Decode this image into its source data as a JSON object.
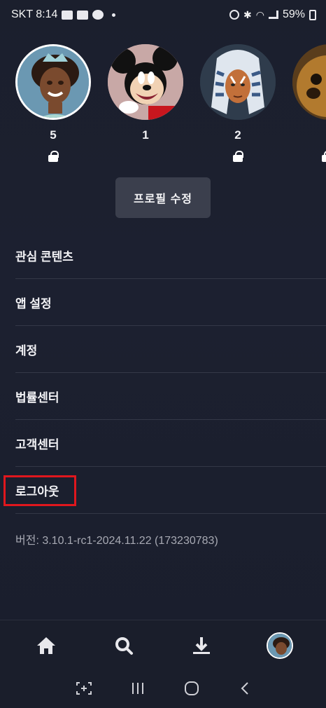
{
  "status_bar": {
    "carrier_time": "SKT 8:14",
    "battery": "59%"
  },
  "profiles": [
    {
      "number": "5",
      "locked": true,
      "selected": true,
      "avatar": "princess-tiana-avatar"
    },
    {
      "number": "1",
      "locked": false,
      "selected": false,
      "avatar": "mickey-mouse-avatar"
    },
    {
      "number": "2",
      "locked": true,
      "selected": false,
      "avatar": "ahsoka-avatar"
    },
    {
      "number": "",
      "locked": true,
      "selected": false,
      "avatar": "animal-avatar"
    }
  ],
  "edit_profile_label": "프로필 수정",
  "menu": {
    "items": [
      {
        "label": "관심 콘텐츠"
      },
      {
        "label": "앱 설정"
      },
      {
        "label": "계정"
      },
      {
        "label": "법률센터"
      },
      {
        "label": "고객센터"
      },
      {
        "label": "로그아웃"
      }
    ]
  },
  "version": "버전: 3.10.1-rc1-2024.11.22 (173230783)",
  "bottom_nav": {
    "items": [
      "home-icon",
      "search-icon",
      "download-icon",
      "profile-avatar"
    ]
  },
  "colors": {
    "background": "#1c2030",
    "highlight": "#e0171d",
    "button": "#3b3f4d"
  }
}
